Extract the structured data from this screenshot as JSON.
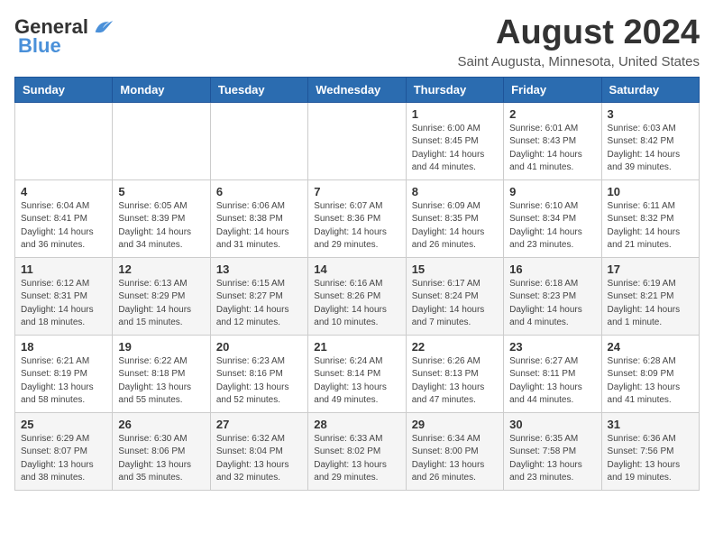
{
  "logo": {
    "general": "General",
    "blue": "Blue"
  },
  "title": {
    "month_year": "August 2024",
    "location": "Saint Augusta, Minnesota, United States"
  },
  "days_of_week": [
    "Sunday",
    "Monday",
    "Tuesday",
    "Wednesday",
    "Thursday",
    "Friday",
    "Saturday"
  ],
  "weeks": [
    {
      "row_alt": false,
      "days": [
        {
          "num": "",
          "info": ""
        },
        {
          "num": "",
          "info": ""
        },
        {
          "num": "",
          "info": ""
        },
        {
          "num": "",
          "info": ""
        },
        {
          "num": "1",
          "info": "Sunrise: 6:00 AM\nSunset: 8:45 PM\nDaylight: 14 hours\nand 44 minutes."
        },
        {
          "num": "2",
          "info": "Sunrise: 6:01 AM\nSunset: 8:43 PM\nDaylight: 14 hours\nand 41 minutes."
        },
        {
          "num": "3",
          "info": "Sunrise: 6:03 AM\nSunset: 8:42 PM\nDaylight: 14 hours\nand 39 minutes."
        }
      ]
    },
    {
      "row_alt": false,
      "days": [
        {
          "num": "4",
          "info": "Sunrise: 6:04 AM\nSunset: 8:41 PM\nDaylight: 14 hours\nand 36 minutes."
        },
        {
          "num": "5",
          "info": "Sunrise: 6:05 AM\nSunset: 8:39 PM\nDaylight: 14 hours\nand 34 minutes."
        },
        {
          "num": "6",
          "info": "Sunrise: 6:06 AM\nSunset: 8:38 PM\nDaylight: 14 hours\nand 31 minutes."
        },
        {
          "num": "7",
          "info": "Sunrise: 6:07 AM\nSunset: 8:36 PM\nDaylight: 14 hours\nand 29 minutes."
        },
        {
          "num": "8",
          "info": "Sunrise: 6:09 AM\nSunset: 8:35 PM\nDaylight: 14 hours\nand 26 minutes."
        },
        {
          "num": "9",
          "info": "Sunrise: 6:10 AM\nSunset: 8:34 PM\nDaylight: 14 hours\nand 23 minutes."
        },
        {
          "num": "10",
          "info": "Sunrise: 6:11 AM\nSunset: 8:32 PM\nDaylight: 14 hours\nand 21 minutes."
        }
      ]
    },
    {
      "row_alt": true,
      "days": [
        {
          "num": "11",
          "info": "Sunrise: 6:12 AM\nSunset: 8:31 PM\nDaylight: 14 hours\nand 18 minutes."
        },
        {
          "num": "12",
          "info": "Sunrise: 6:13 AM\nSunset: 8:29 PM\nDaylight: 14 hours\nand 15 minutes."
        },
        {
          "num": "13",
          "info": "Sunrise: 6:15 AM\nSunset: 8:27 PM\nDaylight: 14 hours\nand 12 minutes."
        },
        {
          "num": "14",
          "info": "Sunrise: 6:16 AM\nSunset: 8:26 PM\nDaylight: 14 hours\nand 10 minutes."
        },
        {
          "num": "15",
          "info": "Sunrise: 6:17 AM\nSunset: 8:24 PM\nDaylight: 14 hours\nand 7 minutes."
        },
        {
          "num": "16",
          "info": "Sunrise: 6:18 AM\nSunset: 8:23 PM\nDaylight: 14 hours\nand 4 minutes."
        },
        {
          "num": "17",
          "info": "Sunrise: 6:19 AM\nSunset: 8:21 PM\nDaylight: 14 hours\nand 1 minute."
        }
      ]
    },
    {
      "row_alt": false,
      "days": [
        {
          "num": "18",
          "info": "Sunrise: 6:21 AM\nSunset: 8:19 PM\nDaylight: 13 hours\nand 58 minutes."
        },
        {
          "num": "19",
          "info": "Sunrise: 6:22 AM\nSunset: 8:18 PM\nDaylight: 13 hours\nand 55 minutes."
        },
        {
          "num": "20",
          "info": "Sunrise: 6:23 AM\nSunset: 8:16 PM\nDaylight: 13 hours\nand 52 minutes."
        },
        {
          "num": "21",
          "info": "Sunrise: 6:24 AM\nSunset: 8:14 PM\nDaylight: 13 hours\nand 49 minutes."
        },
        {
          "num": "22",
          "info": "Sunrise: 6:26 AM\nSunset: 8:13 PM\nDaylight: 13 hours\nand 47 minutes."
        },
        {
          "num": "23",
          "info": "Sunrise: 6:27 AM\nSunset: 8:11 PM\nDaylight: 13 hours\nand 44 minutes."
        },
        {
          "num": "24",
          "info": "Sunrise: 6:28 AM\nSunset: 8:09 PM\nDaylight: 13 hours\nand 41 minutes."
        }
      ]
    },
    {
      "row_alt": true,
      "days": [
        {
          "num": "25",
          "info": "Sunrise: 6:29 AM\nSunset: 8:07 PM\nDaylight: 13 hours\nand 38 minutes."
        },
        {
          "num": "26",
          "info": "Sunrise: 6:30 AM\nSunset: 8:06 PM\nDaylight: 13 hours\nand 35 minutes."
        },
        {
          "num": "27",
          "info": "Sunrise: 6:32 AM\nSunset: 8:04 PM\nDaylight: 13 hours\nand 32 minutes."
        },
        {
          "num": "28",
          "info": "Sunrise: 6:33 AM\nSunset: 8:02 PM\nDaylight: 13 hours\nand 29 minutes."
        },
        {
          "num": "29",
          "info": "Sunrise: 6:34 AM\nSunset: 8:00 PM\nDaylight: 13 hours\nand 26 minutes."
        },
        {
          "num": "30",
          "info": "Sunrise: 6:35 AM\nSunset: 7:58 PM\nDaylight: 13 hours\nand 23 minutes."
        },
        {
          "num": "31",
          "info": "Sunrise: 6:36 AM\nSunset: 7:56 PM\nDaylight: 13 hours\nand 19 minutes."
        }
      ]
    }
  ]
}
